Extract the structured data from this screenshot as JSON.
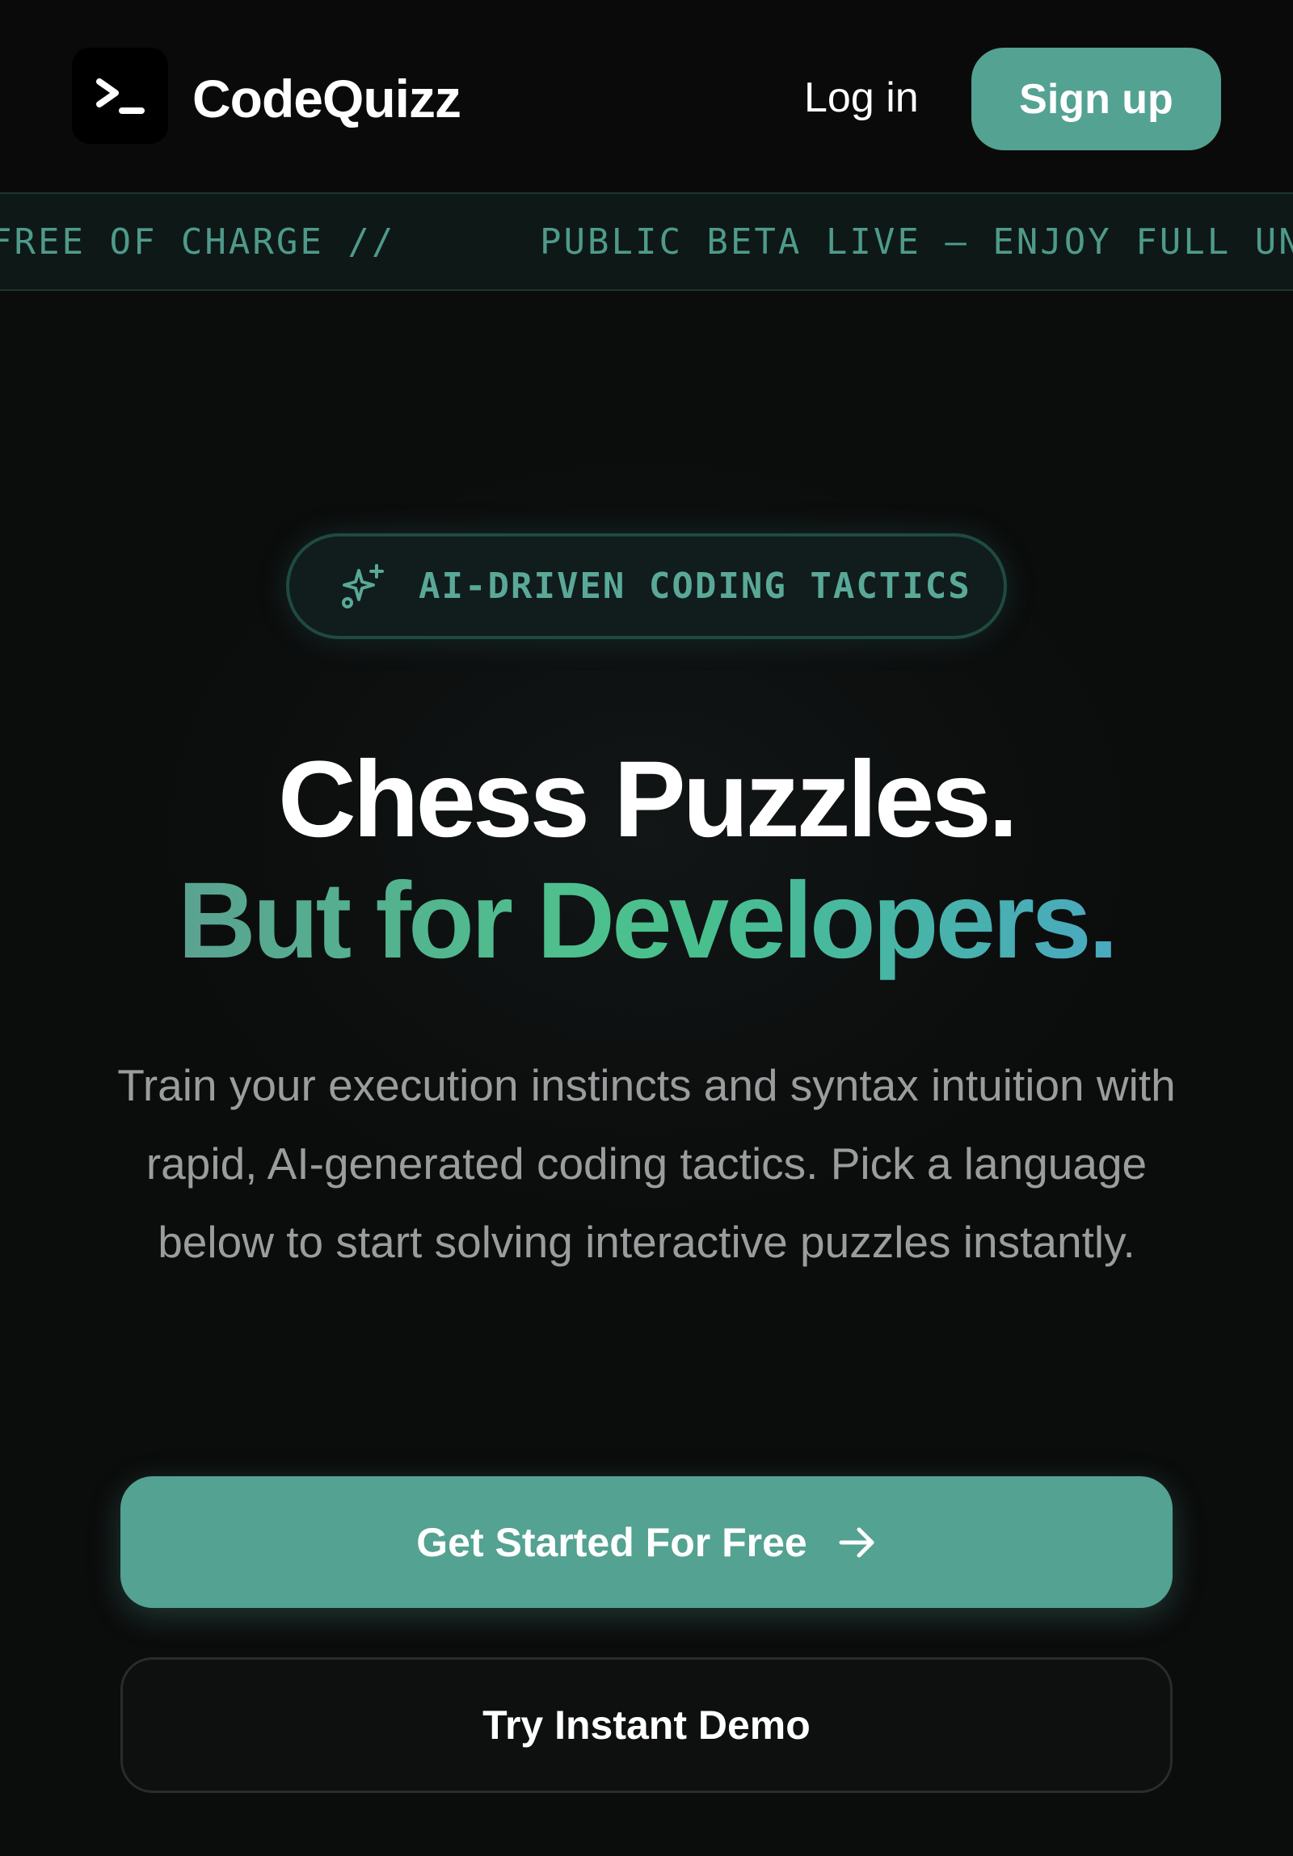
{
  "header": {
    "logo_glyph": ">_",
    "brand": "CodeQuizz",
    "login_label": "Log in",
    "signup_label": "Sign up"
  },
  "marquee": {
    "text_a": "FREE OF CHARGE //",
    "text_b": "PUBLIC BETA LIVE — ENJOY FULL UN"
  },
  "hero": {
    "badge_icon": "sparkles-icon",
    "badge_label": "AI-DRIVEN CODING TACTICS",
    "title_line1": "Chess Puzzles.",
    "title_line2": "But for Developers.",
    "subtitle": "Train your execution instincts and syntax intuition with rapid, AI-generated coding tactics. Pick a language below to start solving interactive puzzles instantly.",
    "primary_cta": "Get Started For Free",
    "primary_cta_icon": "arrow-right-icon",
    "secondary_cta": "Try Instant Demo"
  },
  "colors": {
    "background": "#0b0c0c",
    "accent": "#54a291",
    "gradient_start": "#5aa291",
    "gradient_mid": "#4fbf8e",
    "gradient_end": "#49a9c0",
    "muted_text": "#9a9c9d"
  }
}
